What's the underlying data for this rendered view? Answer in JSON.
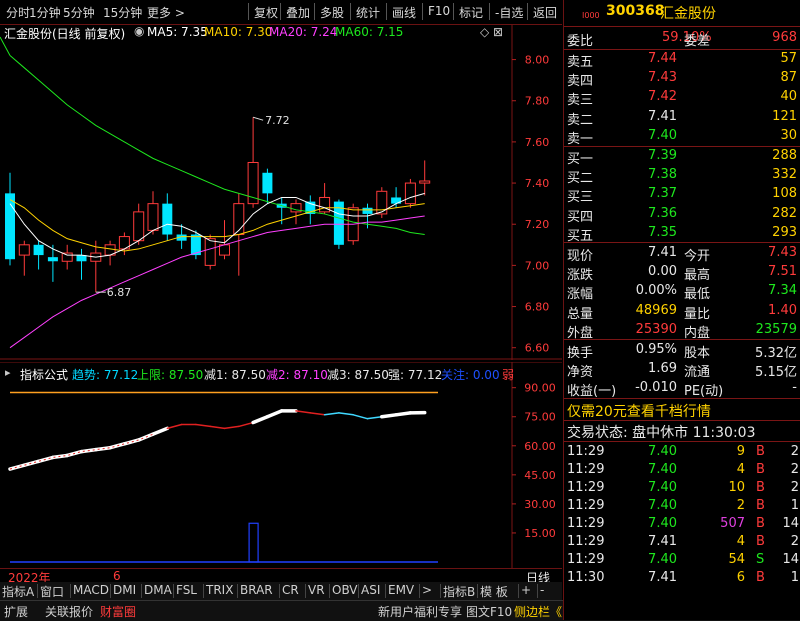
{
  "toolbar": {
    "left_items": [
      "分时",
      "1分钟",
      "5分钟",
      "15分钟",
      "更多 >"
    ],
    "right_items": [
      "复权",
      "叠加",
      "多股",
      "统计",
      "画线",
      "F10",
      "标记",
      "-自选",
      "返回"
    ]
  },
  "main_chart": {
    "legend_name": "汇金股份(日线 前复权)",
    "ma5": "MA5: 7.35",
    "ma10": "MA10: 7.30",
    "ma20": "MA20: 7.24",
    "ma60": "MA60: 7.15",
    "ctrl_icons": "◇ ⊠",
    "high_annot": "7.72",
    "low_annot": "6.87",
    "y_ticks": [
      "8.00",
      "7.80",
      "7.60",
      "7.40",
      "7.20",
      "7.00",
      "6.80",
      "6.60"
    ]
  },
  "indicator": {
    "label": "指标公式",
    "trend": "趋势: 77.12",
    "upper": "上限: 87.50",
    "jian1": "减1: 87.50",
    "jian2": "减2: 87.10",
    "jian3": "减3: 87.50",
    "strong": "强: 77.12",
    "focus": "关注: 0.00",
    "weak": "弱",
    "y_ticks": [
      "90.00",
      "75.00",
      "60.00",
      "45.00",
      "30.00",
      "15.00"
    ]
  },
  "date_axis": {
    "year": "2022年",
    "month": "6",
    "period": "日线"
  },
  "bottom_tabs": [
    "指标A",
    "窗口",
    "MACD",
    "DMI",
    "DMA",
    "FSL",
    "TRIX",
    "BRAR",
    "CR",
    "VR",
    "OBV",
    "ASI",
    "EMV",
    ">",
    "指标B",
    "模 板",
    "+",
    "-"
  ],
  "status_left": [
    "扩展",
    "关联报价",
    "财富圈"
  ],
  "status_mid": [
    "新用户福利专享",
    "图文F10",
    "侧边栏《"
  ],
  "status_right": [
    "笔",
    "价",
    "细",
    "势",
    "联",
    "值",
    "主",
    "筹"
  ],
  "quote": {
    "small_code": "I000",
    "code": "300368",
    "name": "汇金股份",
    "weibi_label": "委比",
    "weibi_value": "59.10%",
    "weicha_label": "委差",
    "weicha_value": "968",
    "asks": [
      {
        "label": "卖五",
        "price": "7.44",
        "vol": "57"
      },
      {
        "label": "卖四",
        "price": "7.43",
        "vol": "87"
      },
      {
        "label": "卖三",
        "price": "7.42",
        "vol": "40"
      },
      {
        "label": "卖二",
        "price": "7.41",
        "vol": "121"
      },
      {
        "label": "卖一",
        "price": "7.40",
        "vol": "30"
      }
    ],
    "bids": [
      {
        "label": "买一",
        "price": "7.39",
        "vol": "288"
      },
      {
        "label": "买二",
        "price": "7.38",
        "vol": "332"
      },
      {
        "label": "买三",
        "price": "7.37",
        "vol": "108"
      },
      {
        "label": "买四",
        "price": "7.36",
        "vol": "282"
      },
      {
        "label": "买五",
        "price": "7.35",
        "vol": "293"
      }
    ],
    "stats": [
      {
        "l1": "现价",
        "v1": "7.41",
        "l2": "今开",
        "v2": "7.43"
      },
      {
        "l1": "涨跌",
        "v1": "0.00",
        "l2": "最高",
        "v2": "7.51"
      },
      {
        "l1": "涨幅",
        "v1": "0.00%",
        "l2": "最低",
        "v2": "7.34"
      },
      {
        "l1": "总量",
        "v1": "48969",
        "l2": "量比",
        "v2": "1.40"
      },
      {
        "l1": "外盘",
        "v1": "25390",
        "l2": "内盘",
        "v2": "23579"
      }
    ],
    "stats2": [
      {
        "l1": "换手",
        "v1": "0.95%",
        "l2": "股本",
        "v2": "5.32亿"
      },
      {
        "l1": "净资",
        "v1": "1.69",
        "l2": "流通",
        "v2": "5.15亿"
      },
      {
        "l1": "收益(一)",
        "v1": "-0.010",
        "l2": "PE(动)",
        "v2": "-"
      }
    ],
    "promo": "仅需20元查看千档行情",
    "trade_status": "交易状态: 盘中休市 11:30:03",
    "ticks": [
      {
        "time": "11:29",
        "price": "7.40",
        "vol": "9",
        "side": "B",
        "n": "2"
      },
      {
        "time": "11:29",
        "price": "7.40",
        "vol": "4",
        "side": "B",
        "n": "2"
      },
      {
        "time": "11:29",
        "price": "7.40",
        "vol": "10",
        "side": "B",
        "n": "2"
      },
      {
        "time": "11:29",
        "price": "7.40",
        "vol": "2",
        "side": "B",
        "n": "1"
      },
      {
        "time": "11:29",
        "price": "7.40",
        "vol": "507",
        "side": "B",
        "n": "14"
      },
      {
        "time": "11:29",
        "price": "7.41",
        "vol": "4",
        "side": "B",
        "n": "2"
      },
      {
        "time": "11:29",
        "price": "7.40",
        "vol": "54",
        "side": "S",
        "n": "14"
      },
      {
        "time": "11:30",
        "price": "7.41",
        "vol": "6",
        "side": "B",
        "n": "1"
      }
    ]
  },
  "chart_data": {
    "type": "candlestick",
    "ylim": [
      6.55,
      8.1
    ],
    "candles": [
      {
        "o": 7.35,
        "h": 7.45,
        "l": 7.0,
        "c": 7.03
      },
      {
        "o": 7.05,
        "h": 7.12,
        "l": 6.95,
        "c": 7.1
      },
      {
        "o": 7.1,
        "h": 7.12,
        "l": 6.98,
        "c": 7.05
      },
      {
        "o": 7.04,
        "h": 7.1,
        "l": 6.92,
        "c": 7.02
      },
      {
        "o": 7.02,
        "h": 7.1,
        "l": 6.98,
        "c": 7.06
      },
      {
        "o": 7.05,
        "h": 7.08,
        "l": 6.93,
        "c": 7.02
      },
      {
        "o": 7.02,
        "h": 7.12,
        "l": 6.87,
        "c": 7.06
      },
      {
        "o": 7.05,
        "h": 7.12,
        "l": 7.0,
        "c": 7.1
      },
      {
        "o": 7.08,
        "h": 7.16,
        "l": 7.05,
        "c": 7.14
      },
      {
        "o": 7.12,
        "h": 7.3,
        "l": 7.1,
        "c": 7.26
      },
      {
        "o": 7.17,
        "h": 7.36,
        "l": 7.15,
        "c": 7.3
      },
      {
        "o": 7.3,
        "h": 7.35,
        "l": 7.12,
        "c": 7.15
      },
      {
        "o": 7.15,
        "h": 7.2,
        "l": 7.08,
        "c": 7.12
      },
      {
        "o": 7.15,
        "h": 7.17,
        "l": 7.03,
        "c": 7.05
      },
      {
        "o": 7.0,
        "h": 7.15,
        "l": 6.98,
        "c": 7.13
      },
      {
        "o": 7.05,
        "h": 7.22,
        "l": 7.03,
        "c": 7.1
      },
      {
        "o": 7.15,
        "h": 7.35,
        "l": 6.95,
        "c": 7.3
      },
      {
        "o": 7.3,
        "h": 7.72,
        "l": 7.28,
        "c": 7.5
      },
      {
        "o": 7.45,
        "h": 7.47,
        "l": 7.3,
        "c": 7.35
      },
      {
        "o": 7.3,
        "h": 7.33,
        "l": 7.2,
        "c": 7.28
      },
      {
        "o": 7.26,
        "h": 7.32,
        "l": 7.2,
        "c": 7.3
      },
      {
        "o": 7.31,
        "h": 7.34,
        "l": 7.2,
        "c": 7.25
      },
      {
        "o": 7.26,
        "h": 7.4,
        "l": 7.25,
        "c": 7.33
      },
      {
        "o": 7.31,
        "h": 7.32,
        "l": 7.08,
        "c": 7.1
      },
      {
        "o": 7.12,
        "h": 7.3,
        "l": 7.1,
        "c": 7.28
      },
      {
        "o": 7.28,
        "h": 7.3,
        "l": 7.18,
        "c": 7.25
      },
      {
        "o": 7.25,
        "h": 7.38,
        "l": 7.23,
        "c": 7.36
      },
      {
        "o": 7.33,
        "h": 7.38,
        "l": 7.28,
        "c": 7.3
      },
      {
        "o": 7.3,
        "h": 7.42,
        "l": 7.28,
        "c": 7.4
      },
      {
        "o": 7.4,
        "h": 7.51,
        "l": 7.34,
        "c": 7.41
      }
    ],
    "ma5": [
      7.3,
      7.2,
      7.12,
      7.08,
      7.05,
      7.05,
      7.04,
      7.05,
      7.08,
      7.12,
      7.17,
      7.2,
      7.19,
      7.16,
      7.12,
      7.11,
      7.17,
      7.25,
      7.3,
      7.33,
      7.33,
      7.3,
      7.28,
      7.25,
      7.24,
      7.24,
      7.26,
      7.3,
      7.33,
      7.35
    ],
    "ma10": [
      7.32,
      7.28,
      7.22,
      7.17,
      7.13,
      7.11,
      7.09,
      7.08,
      7.07,
      7.08,
      7.1,
      7.12,
      7.14,
      7.14,
      7.14,
      7.14,
      7.15,
      7.17,
      7.2,
      7.22,
      7.24,
      7.26,
      7.28,
      7.28,
      7.27,
      7.27,
      7.27,
      7.28,
      7.29,
      7.3
    ],
    "ma20": [
      6.6,
      6.65,
      6.7,
      6.75,
      6.79,
      6.83,
      6.86,
      6.89,
      6.92,
      6.95,
      6.98,
      7.01,
      7.04,
      7.06,
      7.08,
      7.1,
      7.12,
      7.14,
      7.16,
      7.17,
      7.18,
      7.19,
      7.2,
      7.2,
      7.2,
      7.21,
      7.21,
      7.22,
      7.23,
      7.24
    ],
    "ma60": [
      8.02,
      7.96,
      7.9,
      7.84,
      7.78,
      7.73,
      7.68,
      7.64,
      7.6,
      7.56,
      7.52,
      7.49,
      7.46,
      7.43,
      7.4,
      7.37,
      7.35,
      7.33,
      7.31,
      7.29,
      7.27,
      7.26,
      7.25,
      7.23,
      7.21,
      7.2,
      7.19,
      7.18,
      7.16,
      7.15
    ],
    "indicator_ylim": [
      0,
      95
    ],
    "indicator_values": [
      48,
      50,
      52,
      54,
      55,
      57,
      58,
      59,
      61,
      63,
      66,
      69,
      71,
      71,
      70,
      69,
      70,
      72,
      75,
      78,
      78,
      77,
      76,
      77,
      76,
      74,
      75,
      76,
      77,
      77.12
    ],
    "indicator_color": [
      "white",
      "white",
      "white",
      "white",
      "white",
      "white",
      "white",
      "white",
      "white",
      "white",
      "white",
      "red",
      "red",
      "red",
      "red",
      "red",
      "red",
      "white",
      "white",
      "white",
      "red",
      "red",
      "cyan",
      "cyan",
      "cyan",
      "cyan",
      "white",
      "white",
      "white",
      "white"
    ],
    "upper_line": 87.5,
    "volume_bar": {
      "index": 17,
      "value": 20
    }
  }
}
